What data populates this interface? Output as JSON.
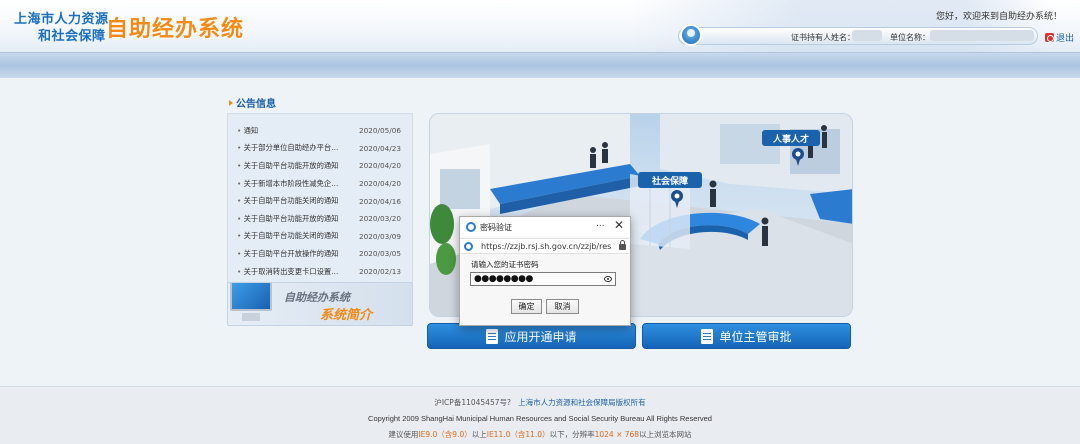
{
  "header": {
    "org_line1": "上海市人力资源",
    "org_line2": "和社会保障",
    "system_title": "自助经办系统",
    "welcome": "您好，欢迎来到自助经办系统！",
    "holder_label": "证书持有人姓名：",
    "unit_label": "单位名称：",
    "logout_label": "退出"
  },
  "notices": {
    "title": "公告信息",
    "items": [
      {
        "title": "通知",
        "date": "2020/05/06"
      },
      {
        "title": "关于部分单位自助经办平台…",
        "date": "2020/04/23"
      },
      {
        "title": "关于自助平台功能开放的通知",
        "date": "2020/04/20"
      },
      {
        "title": "关于新增本市阶段性减免企…",
        "date": "2020/04/20"
      },
      {
        "title": "关于自助平台功能关闭的通知",
        "date": "2020/04/16"
      },
      {
        "title": "关于自助平台功能开放的通知",
        "date": "2020/03/20"
      },
      {
        "title": "关于自助平台功能关闭的通知",
        "date": "2020/03/09"
      },
      {
        "title": "关于自助平台开放操作的通知",
        "date": "2020/03/05"
      },
      {
        "title": "关于取消转出变更卡口设置…",
        "date": "2020/02/13"
      }
    ]
  },
  "intro": {
    "line1": "自助经办系统",
    "line2": "系统简介"
  },
  "illustration": {
    "label_hr": "人事人才",
    "label_social": "社会保障"
  },
  "actions": {
    "apply": "应用开通申请",
    "approve": "单位主管审批"
  },
  "dialog": {
    "title": "密码验证",
    "more": "...",
    "close": "✕",
    "url": "https://zzjb.rsj.sh.gov.cn/zzjb/res",
    "prompt": "请输入您的证书密码",
    "password_mask": "●●●●●●●●",
    "ok": "确定",
    "cancel": "取消"
  },
  "footer": {
    "icp": "沪ICP备11045457号?",
    "owner": "上海市人力资源和社会保障局版权所有",
    "copyright": "Copyright 2009 ShangHai Municipal Human Resources and Social Security Bureau All Rights Reserved",
    "req1": "建议使用",
    "ie_old": "IE9.0（含9.0）",
    "req2": "以上",
    "ie_new": "IE11.0（含11.0）",
    "req3": "以下，分辨率",
    "res": "1024 × 768",
    "req4": "以上浏览本网站"
  }
}
